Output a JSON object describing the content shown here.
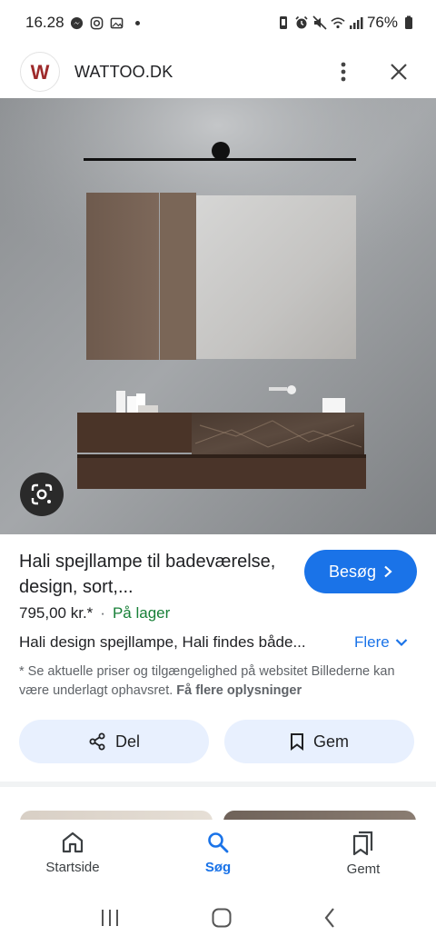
{
  "status_bar": {
    "time": "16.28",
    "battery": "76%"
  },
  "header": {
    "favicon_letter": "W",
    "site_name": "WATTOO.DK"
  },
  "product": {
    "title": "Hali spejllampe til badeværelse, design, sort,...",
    "visit_label": "Besøg",
    "price": "795,00 kr.*",
    "separator": "·",
    "stock": "På lager",
    "description": "Hali design spejllampe, Hali findes både...",
    "more_label": "Flere",
    "disclaimer_text": "* Se aktuelle priser og tilgængelighed på websitet Billederne kan være underlagt ophavsret.",
    "disclaimer_link": "Få flere oplysninger"
  },
  "actions": {
    "share_label": "Del",
    "save_label": "Gem"
  },
  "bottom_nav": [
    {
      "label": "Startside",
      "icon": "home-icon"
    },
    {
      "label": "Søg",
      "icon": "search-icon"
    },
    {
      "label": "Gemt",
      "icon": "bookmarks-icon"
    }
  ],
  "colors": {
    "accent": "#1a73e8",
    "in_stock": "#188038",
    "pill_bg": "#e8f0fe"
  }
}
